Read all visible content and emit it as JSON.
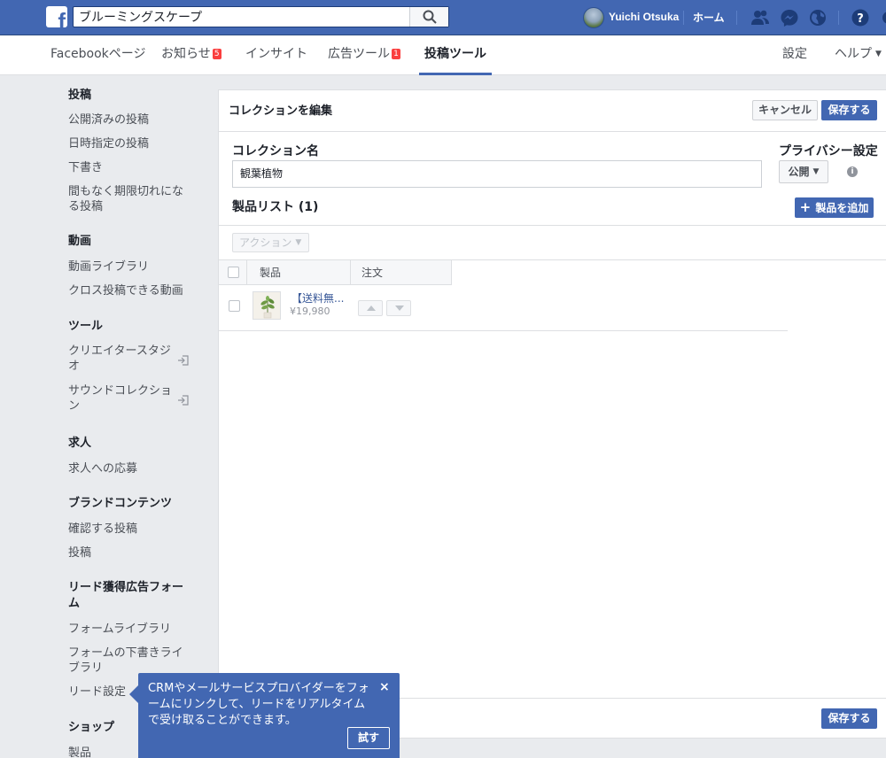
{
  "colors": {
    "brand": "#4267b2",
    "badge": "#fa3e3e",
    "link": "#385898"
  },
  "topbar": {
    "logo_letter": "f",
    "search_value": "ブルーミングスケープ",
    "username": "Yuichi Otsuka",
    "home_label": "ホーム",
    "icons": [
      "friends-icon",
      "messenger-icon",
      "globe-icon",
      "help-icon"
    ]
  },
  "tabs": {
    "items": [
      {
        "label": "Facebookページ"
      },
      {
        "label": "お知らせ",
        "badge": "5"
      },
      {
        "label": "インサイト"
      },
      {
        "label": "広告ツール",
        "badge": "1"
      },
      {
        "label": "投稿ツール",
        "active": true
      }
    ],
    "settings": "設定",
    "help": "ヘルプ"
  },
  "sidebar": {
    "posts_h": "投稿",
    "published": "公開済みの投稿",
    "scheduled": "日時指定の投稿",
    "drafts": "下書き",
    "expiring_1": "間もなく期限切れにな",
    "expiring_2": "る投稿",
    "video_h": "動画",
    "video_library": "動画ライブラリ",
    "crosspost": "クロス投稿できる動画",
    "tools_h": "ツール",
    "creator_1": "クリエイタースタジ",
    "creator_2": "オ",
    "sound_1": "サウンドコレクショ",
    "sound_2": "ン",
    "jobs_h": "求人",
    "job_apps": "求人への応募",
    "brand_h": "ブランドコンテンツ",
    "review_posts": "確認する投稿",
    "brand_posts": "投稿",
    "lead_h_1": "リード獲得広告フォー",
    "lead_h_2": "ム",
    "form_library": "フォームライブラリ",
    "form_draft_1": "フォームの下書きライ",
    "form_draft_2": "ブラリ",
    "lead_settings": "リード設定",
    "shop_h": "ショップ",
    "products": "製品"
  },
  "main": {
    "title": "コレクションを編集",
    "cancel": "キャンセル",
    "save": "保存する",
    "collection_name_label": "コレクション名",
    "collection_name_value": "観葉植物",
    "privacy_label": "プライバシー設定",
    "privacy_value": "公開",
    "product_list_label": "製品リスト (1)",
    "add_product": "製品を追加",
    "actions": "アクション",
    "col_product": "製品",
    "col_order": "注文",
    "product": {
      "name": "【送料無...",
      "price": "¥19,980"
    },
    "footer_save": "保存する"
  },
  "tooltip": {
    "text": "CRMやメールサービスプロバイダーをフォームにリンクして、リードをリアルタイムで受け取ることができます。",
    "close": "×",
    "try": "試す"
  }
}
